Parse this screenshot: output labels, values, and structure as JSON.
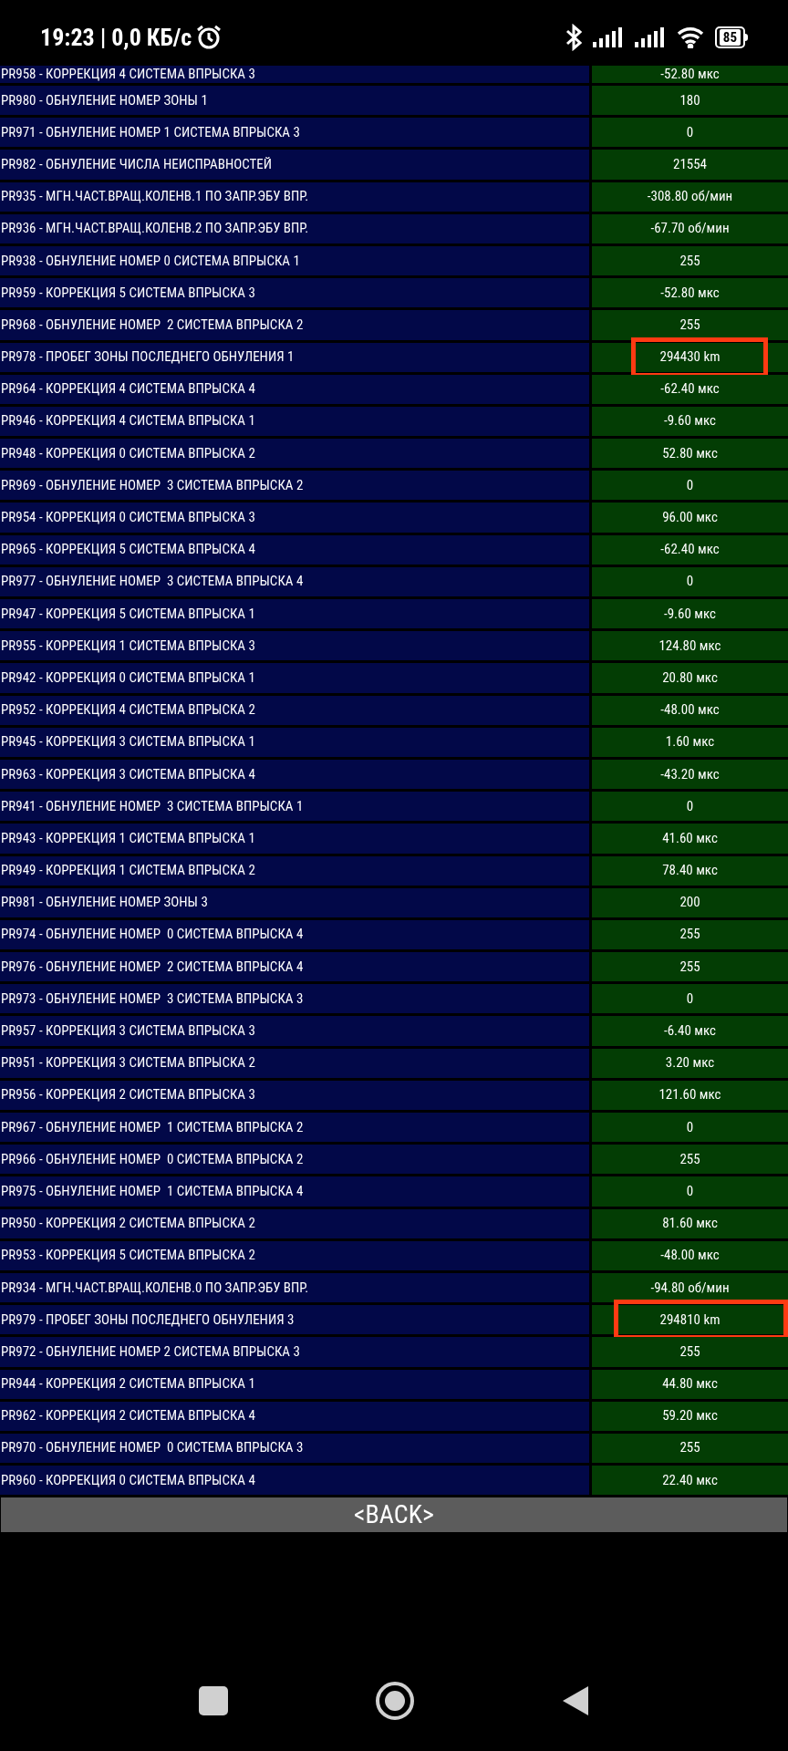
{
  "status_bar": {
    "time": "19:23 | 0,0 КБ/с",
    "battery": "85"
  },
  "rows": [
    {
      "label": "PR958 - КОРРЕКЦИЯ 4 СИСТЕМА ВПРЫСКА 3",
      "value": "-52.80 мкс",
      "highlighted": false
    },
    {
      "label": "PR980 - ОБНУЛЕНИЕ НОМЕР ЗОНЫ 1",
      "value": "180",
      "highlighted": false
    },
    {
      "label": "PR971 - ОБНУЛЕНИЕ НОМЕР 1 СИСТЕМА ВПРЫСКА 3",
      "value": "0",
      "highlighted": false
    },
    {
      "label": "PR982 - ОБНУЛЕНИЕ ЧИСЛА НЕИСПРАВНОСТЕЙ",
      "value": "21554",
      "highlighted": false
    },
    {
      "label": "PR935 - МГН.ЧАСТ.ВРАЩ.КОЛЕНВ.1 ПО ЗАПР.ЭБУ ВПР.",
      "value": "-308.80 об/мин",
      "highlighted": false
    },
    {
      "label": "PR936 - МГН.ЧАСТ.ВРАЩ.КОЛЕНВ.2 ПО ЗАПР.ЭБУ ВПР.",
      "value": "-67.70 об/мин",
      "highlighted": false
    },
    {
      "label": "PR938 - ОБНУЛЕНИЕ НОМЕР 0 СИСТЕМА ВПРЫСКА 1",
      "value": "255",
      "highlighted": false
    },
    {
      "label": "PR959 - КОРРЕКЦИЯ 5 СИСТЕМА ВПРЫСКА 3",
      "value": "-52.80 мкс",
      "highlighted": false
    },
    {
      "label": "PR968 - ОБНУЛЕНИЕ НОМЕР  2 СИСТЕМА ВПРЫСКА 2",
      "value": "255",
      "highlighted": false
    },
    {
      "label": "PR978 - ПРОБЕГ ЗОНЫ ПОСЛЕДНЕГО ОБНУЛЕНИЯ 1",
      "value": "294430 km",
      "highlighted": true
    },
    {
      "label": "PR964 - КОРРЕКЦИЯ 4 СИСТЕМА ВПРЫСКА 4",
      "value": "-62.40 мкс",
      "highlighted": false
    },
    {
      "label": "PR946 - КОРРЕКЦИЯ 4 СИСТЕМА ВПРЫСКА 1",
      "value": "-9.60 мкс",
      "highlighted": false
    },
    {
      "label": "PR948 - КОРРЕКЦИЯ 0 СИСТЕМА ВПРЫСКА 2",
      "value": "52.80 мкс",
      "highlighted": false
    },
    {
      "label": "PR969 - ОБНУЛЕНИЕ НОМЕР  3 СИСТЕМА ВПРЫСКА 2",
      "value": "0",
      "highlighted": false
    },
    {
      "label": "PR954 - КОРРЕКЦИЯ 0 СИСТЕМА ВПРЫСКА 3",
      "value": "96.00 мкс",
      "highlighted": false
    },
    {
      "label": "PR965 - КОРРЕКЦИЯ 5 СИСТЕМА ВПРЫСКА 4",
      "value": "-62.40 мкс",
      "highlighted": false
    },
    {
      "label": "PR977 - ОБНУЛЕНИЕ НОМЕР  3 СИСТЕМА ВПРЫСКА 4",
      "value": "0",
      "highlighted": false
    },
    {
      "label": "PR947 - КОРРЕКЦИЯ 5 СИСТЕМА ВПРЫСКА 1",
      "value": "-9.60 мкс",
      "highlighted": false
    },
    {
      "label": "PR955 - КОРРЕКЦИЯ 1 СИСТЕМА ВПРЫСКА 3",
      "value": "124.80 мкс",
      "highlighted": false
    },
    {
      "label": "PR942 - КОРРЕКЦИЯ 0 СИСТЕМА ВПРЫСКА 1",
      "value": "20.80 мкс",
      "highlighted": false
    },
    {
      "label": "PR952 - КОРРЕКЦИЯ 4 СИСТЕМА ВПРЫСКА 2",
      "value": "-48.00 мкс",
      "highlighted": false
    },
    {
      "label": "PR945 - КОРРЕКЦИЯ 3 СИСТЕМА ВПРЫСКА 1",
      "value": "1.60 мкс",
      "highlighted": false
    },
    {
      "label": "PR963 - КОРРЕКЦИЯ 3 СИСТЕМА ВПРЫСКА 4",
      "value": "-43.20 мкс",
      "highlighted": false
    },
    {
      "label": "PR941 - ОБНУЛЕНИЕ НОМЕР  3 СИСТЕМА ВПРЫСКА 1",
      "value": "0",
      "highlighted": false
    },
    {
      "label": "PR943 - КОРРЕКЦИЯ 1 СИСТЕМА ВПРЫСКА 1",
      "value": "41.60 мкс",
      "highlighted": false
    },
    {
      "label": "PR949 - КОРРЕКЦИЯ 1 СИСТЕМА ВПРЫСКА 2",
      "value": "78.40 мкс",
      "highlighted": false
    },
    {
      "label": "PR981 - ОБНУЛЕНИЕ НОМЕР ЗОНЫ 3",
      "value": "200",
      "highlighted": false
    },
    {
      "label": "PR974 - ОБНУЛЕНИЕ НОМЕР  0 СИСТЕМА ВПРЫСКА 4",
      "value": "255",
      "highlighted": false
    },
    {
      "label": "PR976 - ОБНУЛЕНИЕ НОМЕР  2 СИСТЕМА ВПРЫСКА 4",
      "value": "255",
      "highlighted": false
    },
    {
      "label": "PR973 - ОБНУЛЕНИЕ НОМЕР  3 СИСТЕМА ВПРЫСКА 3",
      "value": "0",
      "highlighted": false
    },
    {
      "label": "PR957 - КОРРЕКЦИЯ 3 СИСТЕМА ВПРЫСКА 3",
      "value": "-6.40 мкс",
      "highlighted": false
    },
    {
      "label": "PR951 - КОРРЕКЦИЯ 3 СИСТЕМА ВПРЫСКА 2",
      "value": "3.20 мкс",
      "highlighted": false
    },
    {
      "label": "PR956 - КОРРЕКЦИЯ 2 СИСТЕМА ВПРЫСКА 3",
      "value": "121.60 мкс",
      "highlighted": false
    },
    {
      "label": "PR967 - ОБНУЛЕНИЕ НОМЕР  1 СИСТЕМА ВПРЫСКА 2",
      "value": "0",
      "highlighted": false
    },
    {
      "label": "PR966 - ОБНУЛЕНИЕ НОМЕР  0 СИСТЕМА ВПРЫСКА 2",
      "value": "255",
      "highlighted": false
    },
    {
      "label": "PR975 - ОБНУЛЕНИЕ НОМЕР  1 СИСТЕМА ВПРЫСКА 4",
      "value": "0",
      "highlighted": false
    },
    {
      "label": "PR950 - КОРРЕКЦИЯ 2 СИСТЕМА ВПРЫСКА 2",
      "value": "81.60 мкс",
      "highlighted": false
    },
    {
      "label": "PR953 - КОРРЕКЦИЯ 5 СИСТЕМА ВПРЫСКА 2",
      "value": "-48.00 мкс",
      "highlighted": false
    },
    {
      "label": "PR934 - МГН.ЧАСТ.ВРАЩ.КОЛЕНВ.0 ПО ЗАПР.ЭБУ ВПР.",
      "value": "-94.80 об/мин",
      "highlighted": false
    },
    {
      "label": "PR979 - ПРОБЕГ ЗОНЫ ПОСЛЕДНЕГО ОБНУЛЕНИЯ 3",
      "value": "294810 km",
      "highlighted": true
    },
    {
      "label": "PR972 - ОБНУЛЕНИЕ НОМЕР 2 СИСТЕМА ВПРЫСКА 3",
      "value": "255",
      "highlighted": false
    },
    {
      "label": "PR944 - КОРРЕКЦИЯ 2 СИСТЕМА ВПРЫСКА 1",
      "value": "44.80 мкс",
      "highlighted": false
    },
    {
      "label": "PR962 - КОРРЕКЦИЯ 2 СИСТЕМА ВПРЫСКА 4",
      "value": "59.20 мкс",
      "highlighted": false
    },
    {
      "label": "PR970 - ОБНУЛЕНИЕ НОМЕР  0 СИСТЕМА ВПРЫСКА 3",
      "value": "255",
      "highlighted": false
    },
    {
      "label": "PR960 - КОРРЕКЦИЯ 0 СИСТЕМА ВПРЫСКА 4",
      "value": "22.40 мкс",
      "highlighted": false
    }
  ],
  "back_button": "<BACK>"
}
